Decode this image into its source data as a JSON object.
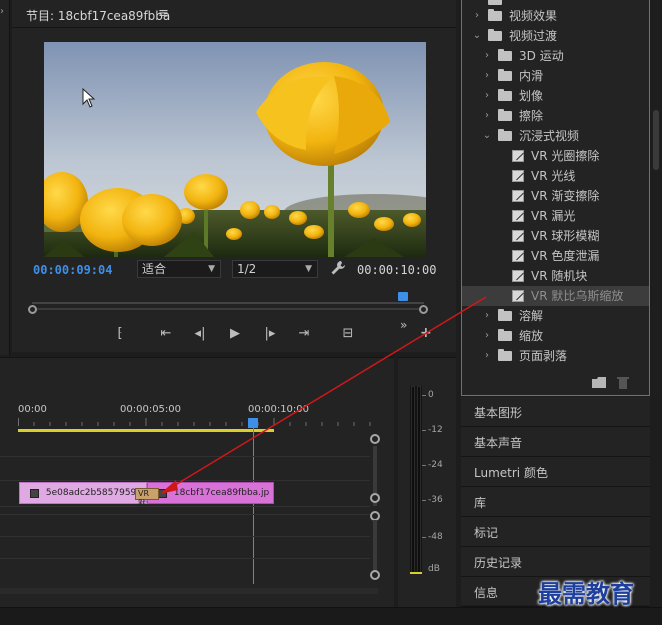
{
  "program_monitor": {
    "title": "节目: 18cbf17cea89fbba",
    "menu_icon": "hamburger-icon",
    "current_timecode": "00:00:09:04",
    "fit_select": "适合",
    "resolution_select": "1/2",
    "duration_timecode": "00:00:10:00",
    "transport_icons": [
      "mark-in-icon",
      "go-to-in-icon",
      "step-back-icon",
      "play-icon",
      "step-forward-icon",
      "go-to-out-icon",
      "export-frame-icon"
    ],
    "more_icon": "double-chevron-icon",
    "add_icon": "plus-icon"
  },
  "timeline": {
    "ruler": [
      "00:00",
      "00:00:05:00",
      "00:00:10:00"
    ],
    "clip_a_label": "5e08adc2b5857959",
    "clip_b_label": "18cbf17cea89fbba.jp",
    "transition_badge": "VR 默"
  },
  "audio_meter": {
    "scale": [
      "0",
      "-12",
      "-24",
      "-36",
      "-48",
      "dB"
    ]
  },
  "effects_panel": {
    "items": [
      {
        "label": "视频效果",
        "level": 1,
        "type": "folder",
        "expanded": false
      },
      {
        "label": "视频过渡",
        "level": 1,
        "type": "folder",
        "expanded": true
      },
      {
        "label": "3D 运动",
        "level": 2,
        "type": "folder",
        "expanded": false
      },
      {
        "label": "内滑",
        "level": 2,
        "type": "folder",
        "expanded": false
      },
      {
        "label": "划像",
        "level": 2,
        "type": "folder",
        "expanded": false
      },
      {
        "label": "擦除",
        "level": 2,
        "type": "folder",
        "expanded": false
      },
      {
        "label": "沉浸式视频",
        "level": 2,
        "type": "folder",
        "expanded": true
      },
      {
        "label": "VR 光圈擦除",
        "level": 3,
        "type": "effect"
      },
      {
        "label": "VR 光线",
        "level": 3,
        "type": "effect"
      },
      {
        "label": "VR 渐变擦除",
        "level": 3,
        "type": "effect"
      },
      {
        "label": "VR 漏光",
        "level": 3,
        "type": "effect"
      },
      {
        "label": "VR 球形模糊",
        "level": 3,
        "type": "effect"
      },
      {
        "label": "VR 色度泄漏",
        "level": 3,
        "type": "effect"
      },
      {
        "label": "VR 随机块",
        "level": 3,
        "type": "effect"
      },
      {
        "label": "VR 默比乌斯缩放",
        "level": 3,
        "type": "effect",
        "selected": true
      },
      {
        "label": "溶解",
        "level": 2,
        "type": "folder",
        "expanded": false
      },
      {
        "label": "缩放",
        "level": 2,
        "type": "folder",
        "expanded": false
      },
      {
        "label": "页面剥落",
        "level": 2,
        "type": "folder",
        "expanded": false
      }
    ],
    "bottom_icons": [
      "new-folder-icon",
      "trash-icon"
    ]
  },
  "panels": [
    "基本图形",
    "基本声音",
    "Lumetri 颜色",
    "库",
    "标记",
    "历史记录",
    "信息"
  ],
  "watermark": "最需教育",
  "colors": {
    "accent_blue": "#3d8fe8",
    "work_area_yellow": "#d8cf2a",
    "clip_pink": "#d972d8",
    "arrow_red": "#d01818"
  }
}
